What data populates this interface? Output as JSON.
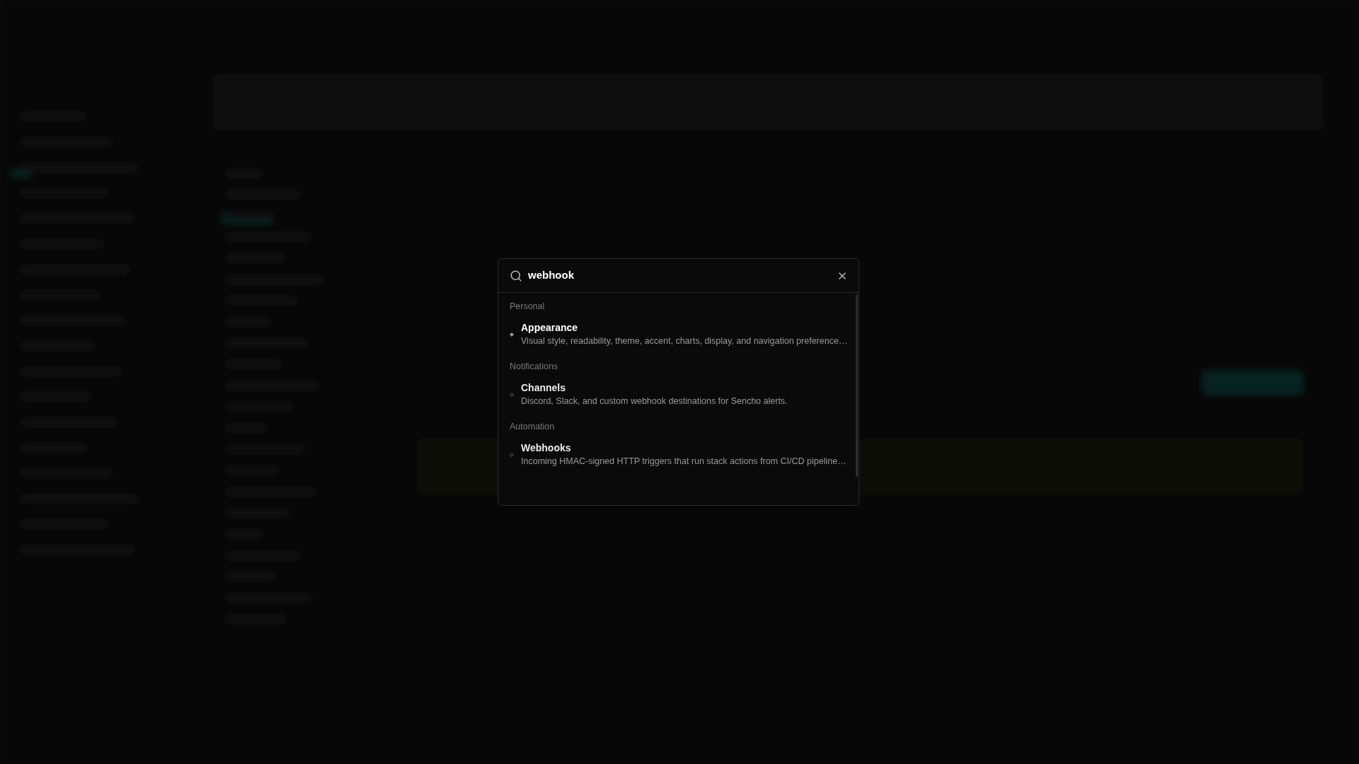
{
  "search": {
    "value": "webhook"
  },
  "groups": [
    {
      "heading": "Personal",
      "items": [
        {
          "title": "Appearance",
          "description": "Visual style, readability, theme, accent, charts, display, and navigation preference…",
          "selected": true
        }
      ]
    },
    {
      "heading": "Notifications",
      "items": [
        {
          "title": "Channels",
          "description": "Discord, Slack, and custom webhook destinations for Sencho alerts.",
          "selected": false
        }
      ]
    },
    {
      "heading": "Automation",
      "items": [
        {
          "title": "Webhooks",
          "description": "Incoming HMAC-signed HTTP triggers that run stack actions from CI/CD pipeline…",
          "selected": false
        }
      ]
    }
  ]
}
